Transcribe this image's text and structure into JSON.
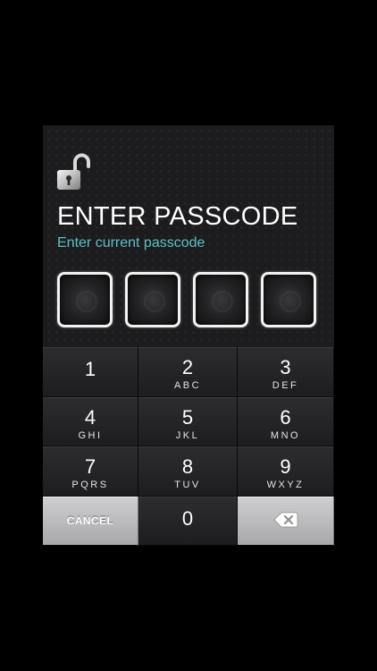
{
  "header": {
    "title": "ENTER PASSCODE",
    "subtitle": "Enter current passcode"
  },
  "passcode": {
    "length": 4,
    "entered": 0
  },
  "keypad": {
    "keys": [
      {
        "digit": "1",
        "letters": ""
      },
      {
        "digit": "2",
        "letters": "ABC"
      },
      {
        "digit": "3",
        "letters": "DEF"
      },
      {
        "digit": "4",
        "letters": "GHI"
      },
      {
        "digit": "5",
        "letters": "JKL"
      },
      {
        "digit": "6",
        "letters": "MNO"
      },
      {
        "digit": "7",
        "letters": "PQRS"
      },
      {
        "digit": "8",
        "letters": "TUV"
      },
      {
        "digit": "9",
        "letters": "WXYZ"
      }
    ],
    "cancel_label": "CANCEL",
    "zero": "0"
  },
  "icons": {
    "lock": "unlocked-padlock-icon",
    "backspace": "backspace-icon"
  },
  "colors": {
    "accent": "#5bc0c9",
    "background": "#1c1c1e"
  }
}
